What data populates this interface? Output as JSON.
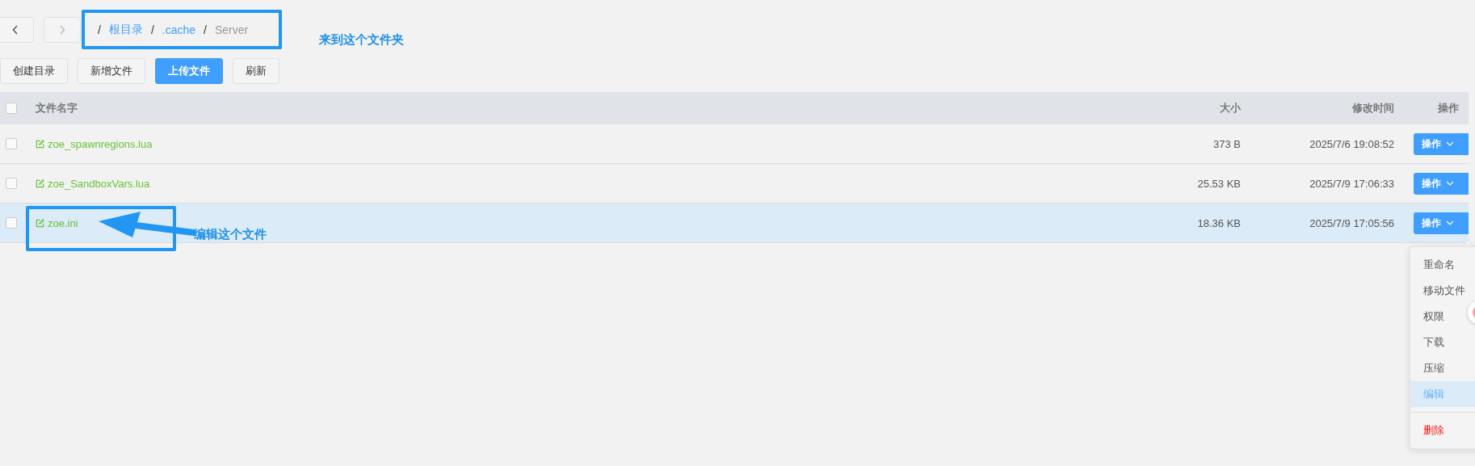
{
  "breadcrumb": [
    {
      "separator": "/",
      "label": "根目录",
      "kind": "link"
    },
    {
      "separator": "/",
      "label": ".cache",
      "kind": "link"
    },
    {
      "separator": "/",
      "label": "Server",
      "kind": "current"
    }
  ],
  "toolbar": [
    {
      "label": "创建目录",
      "primary": false
    },
    {
      "label": "新增文件",
      "primary": false
    },
    {
      "label": "上传文件",
      "primary": true
    },
    {
      "label": "刷新",
      "primary": false
    }
  ],
  "table": {
    "all_checked": false,
    "columns": [
      "文件名字",
      "大小",
      "修改时间",
      "操作"
    ],
    "rows": [
      {
        "name": "zoe_spawnregions.lua",
        "size": "373 B",
        "modified": "2025/7/6 19:08:52",
        "action": "操作",
        "selected": false,
        "checked": false
      },
      {
        "name": "zoe_SandboxVars.lua",
        "size": "25.53 KB",
        "modified": "2025/7/9 17:06:33",
        "action": "操作",
        "selected": false,
        "checked": false
      },
      {
        "name": "zoe.ini",
        "size": "18.36 KB",
        "modified": "2025/7/9 17:05:56",
        "action": "操作",
        "selected": true,
        "checked": false
      }
    ]
  },
  "menu": [
    {
      "label": "重命名",
      "kind": "normal",
      "selected": false
    },
    {
      "label": "移动文件",
      "kind": "normal",
      "selected": false
    },
    {
      "label": "权限",
      "kind": "normal",
      "selected": false
    },
    {
      "label": "下载",
      "kind": "normal",
      "selected": false
    },
    {
      "label": "压缩",
      "kind": "normal",
      "selected": false
    },
    {
      "label": "编辑",
      "kind": "normal",
      "selected": true
    },
    {
      "label": "删除",
      "kind": "danger",
      "selected": false
    }
  ],
  "annotations": {
    "folder_note": "来到这个文件夹",
    "file_note": "编辑这个文件"
  }
}
